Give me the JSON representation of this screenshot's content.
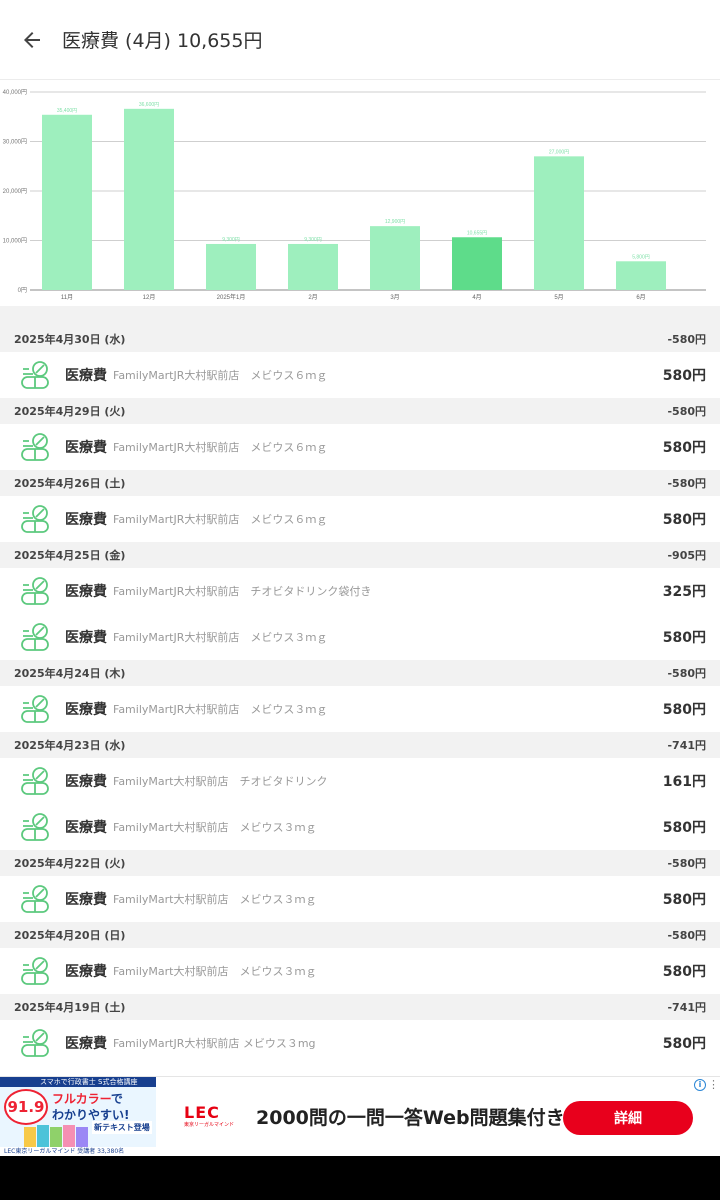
{
  "header": {
    "title": "医療費 (4月) 10,655円"
  },
  "chart_data": {
    "type": "bar",
    "categories": [
      "11月",
      "12月",
      "2025年1月",
      "2月",
      "3月",
      "4月",
      "5月",
      "6月"
    ],
    "values": [
      35400,
      36600,
      9300,
      9300,
      12900,
      10655,
      27000,
      5800
    ],
    "data_labels": [
      "35,400円",
      "36,600円",
      "9,300円",
      "9,300円",
      "12,900円",
      "10,655円",
      "27,000円",
      "5,800円"
    ],
    "highlight_index": 5,
    "y_ticks": [
      "0円",
      "10,000円",
      "20,000円",
      "30,000円",
      "40,000円"
    ],
    "ylim": [
      0,
      40000
    ],
    "grid": true,
    "colors": {
      "bar": "#9eefbe",
      "highlight": "#5edc8a"
    }
  },
  "days": [
    {
      "date": "2025年4月30日 (水)",
      "total": "-580円",
      "items": [
        {
          "category": "医療費",
          "memo": "FamilyMartJR大村駅前店　メビウス６ｍｇ",
          "amount": "580円"
        }
      ]
    },
    {
      "date": "2025年4月29日 (火)",
      "total": "-580円",
      "items": [
        {
          "category": "医療費",
          "memo": "FamilyMartJR大村駅前店　メビウス６ｍｇ",
          "amount": "580円"
        }
      ]
    },
    {
      "date": "2025年4月26日 (土)",
      "total": "-580円",
      "items": [
        {
          "category": "医療費",
          "memo": "FamilyMartJR大村駅前店　メビウス６ｍｇ",
          "amount": "580円"
        }
      ]
    },
    {
      "date": "2025年4月25日 (金)",
      "total": "-905円",
      "items": [
        {
          "category": "医療費",
          "memo": "FamilyMartJR大村駅前店　チオビタドリンク袋付き",
          "amount": "325円"
        },
        {
          "category": "医療費",
          "memo": "FamilyMartJR大村駅前店　メビウス３ｍｇ",
          "amount": "580円"
        }
      ]
    },
    {
      "date": "2025年4月24日 (木)",
      "total": "-580円",
      "items": [
        {
          "category": "医療費",
          "memo": "FamilyMartJR大村駅前店　メビウス３ｍｇ",
          "amount": "580円"
        }
      ]
    },
    {
      "date": "2025年4月23日 (水)",
      "total": "-741円",
      "items": [
        {
          "category": "医療費",
          "memo": "FamilyMart大村駅前店　チオビタドリンク",
          "amount": "161円"
        },
        {
          "category": "医療費",
          "memo": "FamilyMart大村駅前店　メビウス３ｍｇ",
          "amount": "580円"
        }
      ]
    },
    {
      "date": "2025年4月22日 (火)",
      "total": "-580円",
      "items": [
        {
          "category": "医療費",
          "memo": "FamilyMart大村駅前店　メビウス３ｍｇ",
          "amount": "580円"
        }
      ]
    },
    {
      "date": "2025年4月20日 (日)",
      "total": "-580円",
      "items": [
        {
          "category": "医療費",
          "memo": "FamilyMart大村駅前店　メビウス３ｍｇ",
          "amount": "580円"
        }
      ]
    },
    {
      "date": "2025年4月19日 (土)",
      "total": "-741円",
      "items": [
        {
          "category": "医療費",
          "memo": "FamilyMartJR大村駅前店 メビウス３mg",
          "amount": "580円"
        }
      ]
    }
  ],
  "ad": {
    "thumb_band": "スマホで行政書士 S式合格講座",
    "thumb_rate": "91.9",
    "thumb_catch_1": "フルカラー",
    "thumb_catch_1b": "で",
    "thumb_catch_2": "わかりやすい!",
    "thumb_sub": "新テキスト登場",
    "thumb_foot": "LEC東京リーガルマインド 受講者 33,380名",
    "logo_text": "LEC",
    "logo_sub": "東京リーガルマインド",
    "headline": "2000問の一問一答Web問題集付き",
    "cta_label": "詳細",
    "info_icon": "info-icon",
    "menu_icon": "more-vert-icon"
  },
  "icons": {
    "back": "arrow-left-icon",
    "category": "pill-icon"
  },
  "colors": {
    "icon_green": "#5cc97e",
    "accent_red": "#e8001c"
  }
}
